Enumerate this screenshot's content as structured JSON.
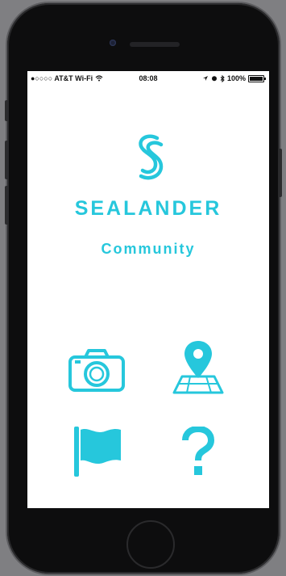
{
  "status_bar": {
    "carrier": "●○○○○ AT&T Wi-Fi",
    "time": "08:08",
    "battery": "100%"
  },
  "app": {
    "brand_name": "SEALANDER",
    "subtitle": "Community",
    "accent_color": "#26c7dc"
  },
  "menu": {
    "items": [
      {
        "icon": "camera-icon"
      },
      {
        "icon": "map-pin-icon"
      },
      {
        "icon": "flag-icon"
      },
      {
        "icon": "question-mark-icon"
      }
    ]
  }
}
